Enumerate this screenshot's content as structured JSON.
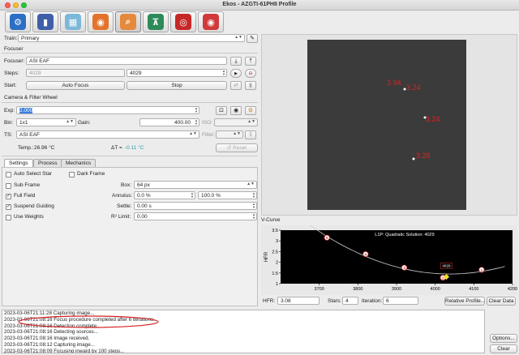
{
  "window": {
    "title": "Ekos - AZGTI-61PHII Profile"
  },
  "tabs": [
    {
      "name": "setup",
      "color": "#2c6fc4",
      "glyph": "⚙"
    },
    {
      "name": "mount",
      "color": "#3e5fa8",
      "glyph": "▮"
    },
    {
      "name": "capture",
      "color": "#7cb8d8",
      "glyph": "▦"
    },
    {
      "name": "focus-camera",
      "color": "#e3732c",
      "glyph": "◉"
    },
    {
      "name": "focus",
      "color": "#e58a3c",
      "glyph": "⌕"
    },
    {
      "name": "align",
      "color": "#2e8a5a",
      "glyph": "⊼"
    },
    {
      "name": "guide",
      "color": "#c62828",
      "glyph": "◎"
    },
    {
      "name": "analyze",
      "color": "#d03a3a",
      "glyph": "◉"
    }
  ],
  "train": {
    "label": "Train:",
    "value": "Primary"
  },
  "focuser": {
    "section": "Focuser",
    "focuser_label": "Focuser:",
    "focuser_value": "ASI EAF",
    "steps_label": "Steps:",
    "steps_current": "4029",
    "steps_target": "4029",
    "start_label": "Start:",
    "auto_focus": "Auto Focus",
    "stop": "Stop"
  },
  "camera": {
    "section": "Camera & Filter Wheel",
    "exp_label": "Exp:",
    "exp_value": "2.000",
    "bin_label": "Bin:",
    "bin_value": "1x1",
    "gain_label": "Gain:",
    "gain_value": "400.00",
    "iso_label": "ISO:",
    "ts_label": "TS:",
    "ts_value": "ASI EAF",
    "filter_label": "Filter:",
    "temp_label": "Temp.:",
    "temp_value": "26.96 °C",
    "delta_label": "ΔT =",
    "delta_value": "-0.11 °C",
    "reset": "Reset"
  },
  "subtabs": [
    "Settings",
    "Process",
    "Mechanics"
  ],
  "settings": {
    "auto_select_star": "Auto Select Star",
    "dark_frame": "Dark Frame",
    "sub_frame": "Sub Frame",
    "box_label": "Box:",
    "box_value": "64 px",
    "full_field": "Full Field",
    "annulus_label": "Annulus:",
    "annulus_inner": "0.0 %",
    "annulus_outer": "100.0 %",
    "suspend_guiding": "Suspend Guiding",
    "settle_label": "Settle:",
    "settle_value": "0.00 s",
    "use_weights": "Use Weights",
    "r2_label": "R² Limit:",
    "r2_value": "0.00"
  },
  "star_image": {
    "stars": [
      {
        "label": "3.94"
      },
      {
        "label": "3.24"
      },
      {
        "label": "3.24"
      },
      {
        "label": "3.28"
      }
    ]
  },
  "vcurve": {
    "title": "V-Curve",
    "solution": "L1P: Quadratic Solution: 4029",
    "marker_label": "4029",
    "hfr_label": "HFR:",
    "hfr_value": "3.08",
    "stars_label": "Stars:",
    "stars_value": "4",
    "iteration_label": "Iteration:",
    "iteration_value": "6",
    "relative_profile": "Relative Profile...",
    "clear_data": "Clear Data"
  },
  "chart_data": {
    "type": "scatter",
    "title": "L1P: Quadratic Solution: 4029",
    "xlabel": "",
    "ylabel": "HFR",
    "xlim": [
      3600,
      4200
    ],
    "ylim": [
      1.0,
      3.5
    ],
    "xticks": [
      "3700",
      "3800",
      "3900",
      "4000",
      "4100",
      "4200"
    ],
    "yticks": [
      "1",
      "1.5",
      "2",
      "2.5",
      "3",
      "3.5"
    ],
    "points": [
      {
        "n": "5",
        "x": 3720,
        "y": 3.15
      },
      {
        "n": "4",
        "x": 3820,
        "y": 2.38
      },
      {
        "n": "3",
        "x": 3920,
        "y": 1.75
      },
      {
        "n": "2",
        "x": 4020,
        "y": 1.28
      },
      {
        "n": "1",
        "x": 4120,
        "y": 1.65
      }
    ],
    "solution": {
      "x": 4029,
      "y": 1.32
    },
    "grid": false
  },
  "log": {
    "lines": [
      "2023-03-06T21:11:28 Capturing image...",
      "2023-03-06T21:08:16 Focus procedure completed after 6 iterations.",
      "2023-03-06T21:08:16 Detection complete.",
      "2023-03-06T21:08:16 Detecting sources...",
      "2023-03-06T21:08:16 Image received.",
      "2023-03-06T21:08:12 Capturing image...",
      "2023-03-06T21:08:09 Focusing inward by 100 steps..."
    ],
    "options": "Options...",
    "clear": "Clear"
  },
  "colors": {
    "highlight_ellipse": "#d32020",
    "star_label": "#e02020",
    "plot_bg": "#000000"
  }
}
